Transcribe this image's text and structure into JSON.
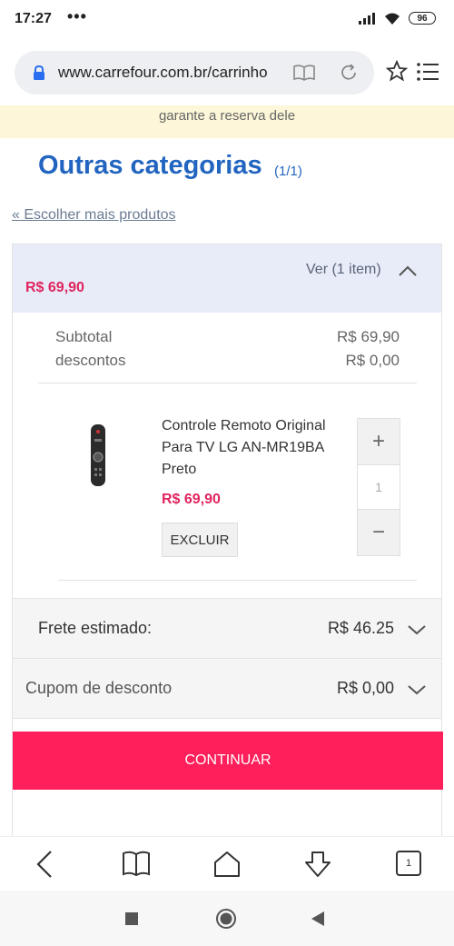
{
  "status": {
    "time": "17:27",
    "dots": "•••",
    "battery": "96"
  },
  "browser": {
    "url": "www.carrefour.com.br/carrinho",
    "tabs": "1"
  },
  "notice": "garante a reserva dele",
  "page": {
    "title": "Outras categorias",
    "count": "(1/1)",
    "back_link": "« Escolher mais produtos"
  },
  "cart": {
    "view_label": "Ver (1 item)",
    "header_price": "R$ 69,90",
    "subtotal_label": "Subtotal",
    "subtotal_value": "R$ 69,90",
    "discounts_label": "descontos",
    "discounts_value": "R$ 0,00",
    "product": {
      "name": "Controle Remoto Original Para TV LG AN-MR19BA Preto",
      "price": "R$ 69,90",
      "delete_label": "EXCLUIR",
      "quantity": "1",
      "plus": "+",
      "minus": "−"
    },
    "shipping_label": "Frete estimado:",
    "shipping_value": "R$ 46.25",
    "coupon_label": "Cupom de desconto",
    "coupon_value": "R$ 0,00",
    "continue_label": "CONTINUAR"
  },
  "colors": {
    "accent": "#ff1f5a",
    "price": "#e0245e",
    "title": "#2265c0",
    "header_bg": "#e7ecf8"
  }
}
